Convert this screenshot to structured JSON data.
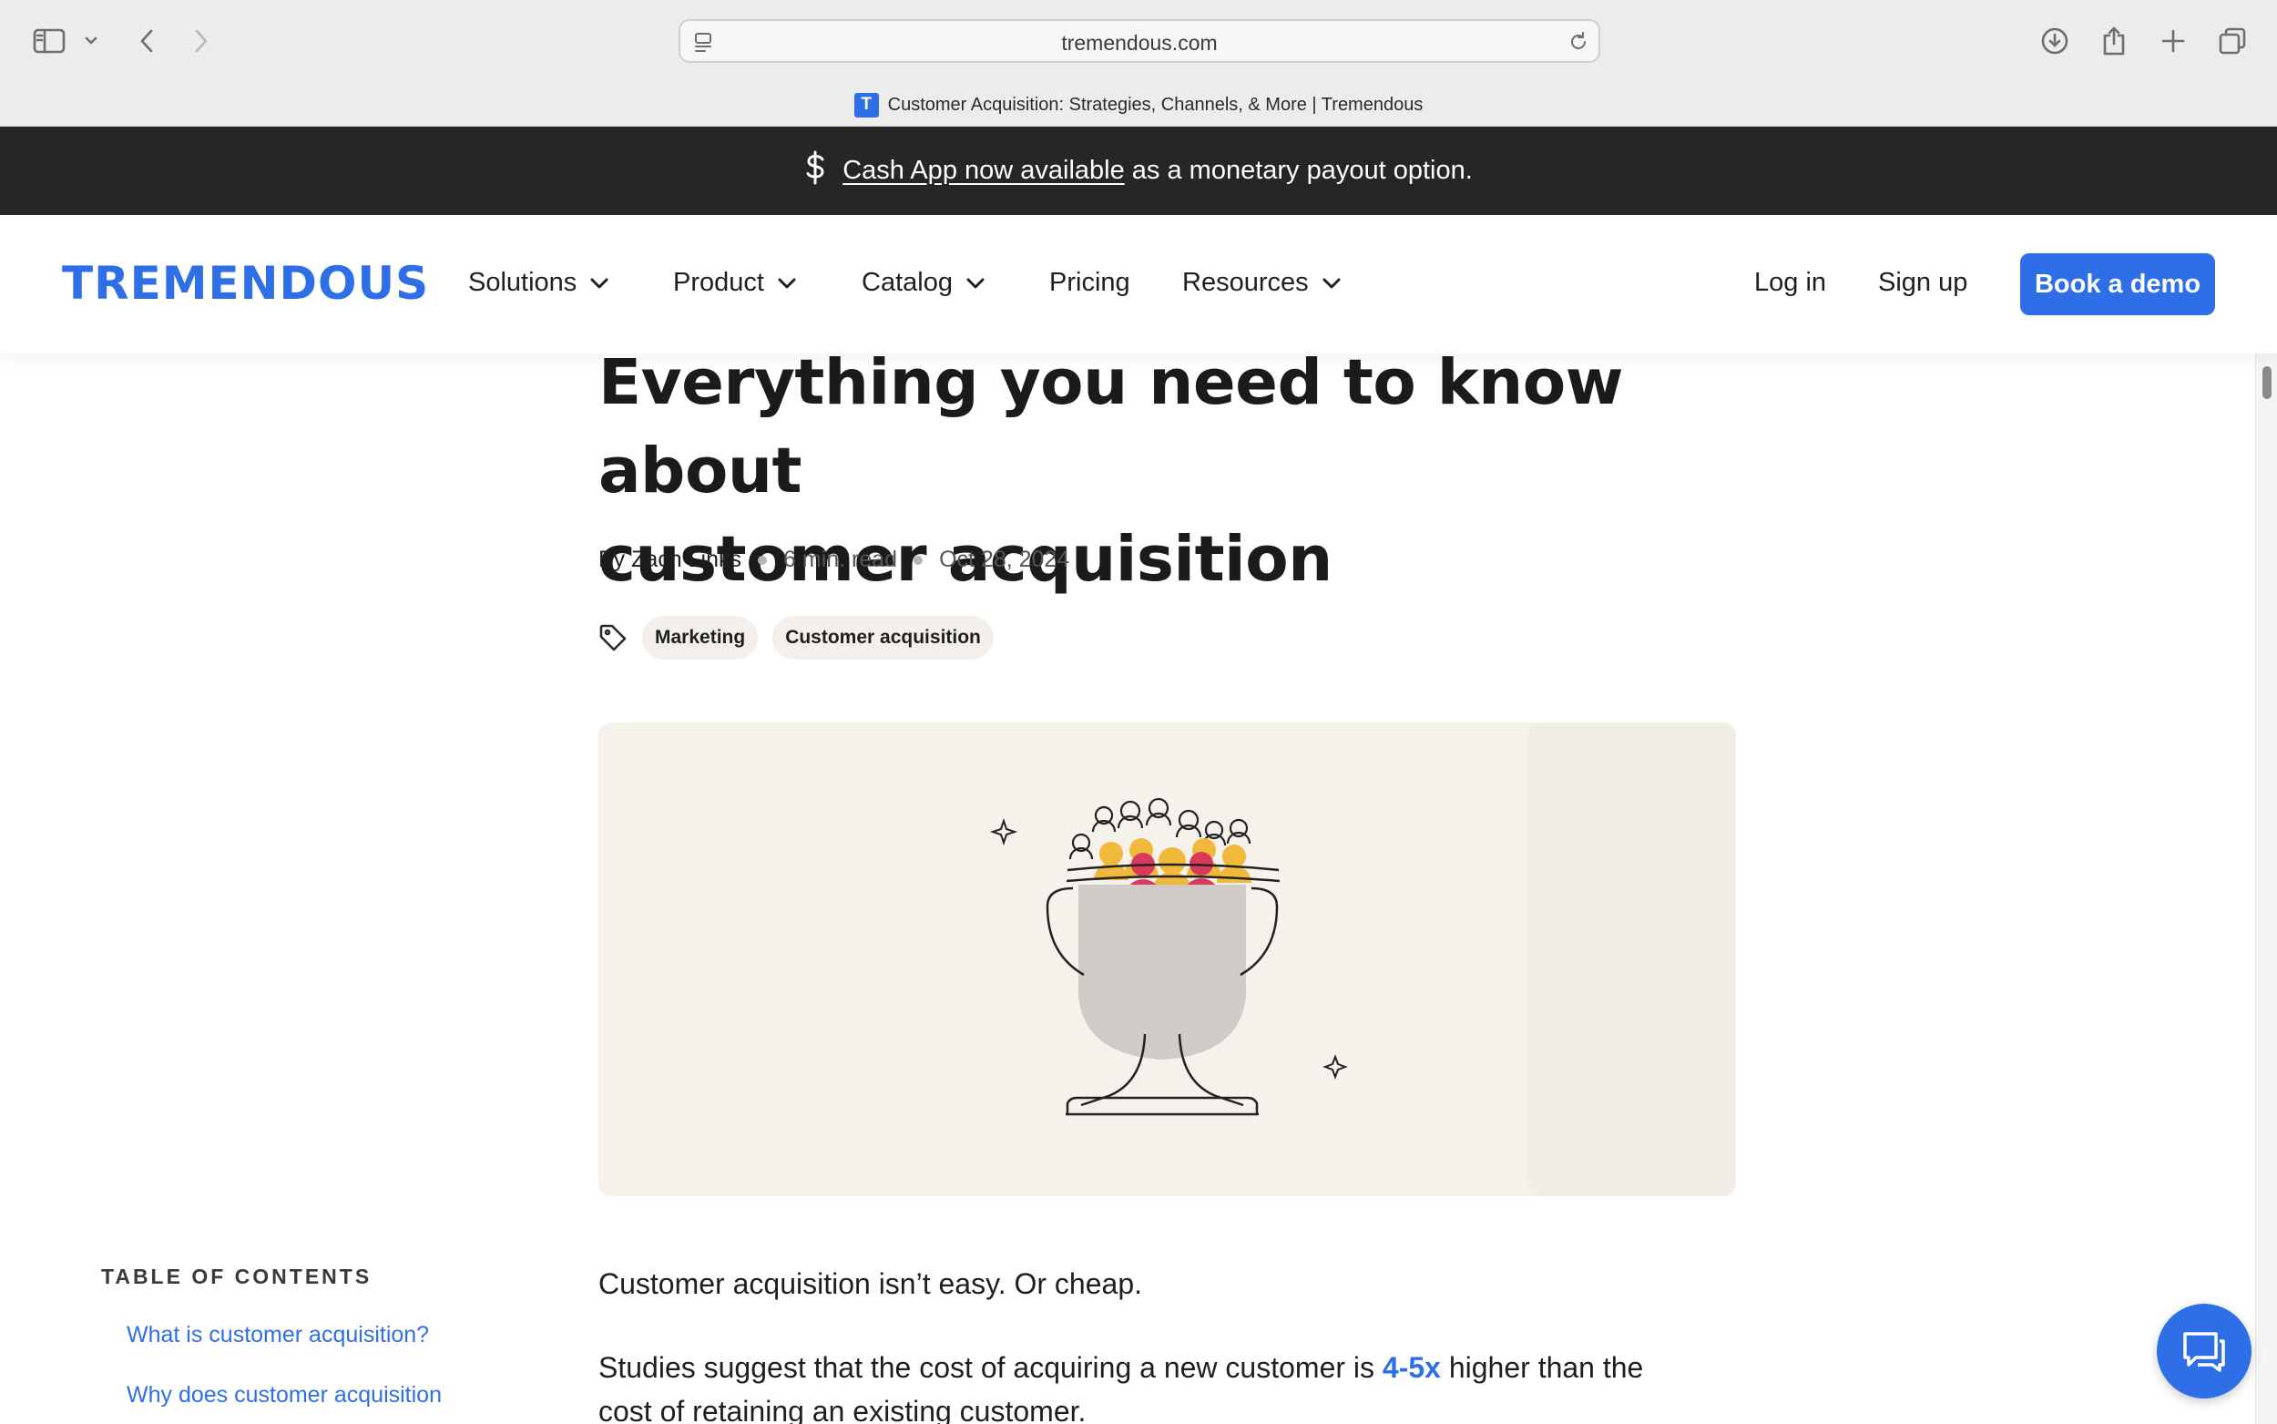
{
  "browser": {
    "url": "tremendous.com",
    "tab_title": "Customer Acquisition: Strategies, Channels, & More | Tremendous",
    "favicon_letter": "T"
  },
  "announcement": {
    "link_text": "Cash App now available",
    "rest_text": "as a monetary payout option.",
    "icon": "dollar-icon"
  },
  "nav": {
    "logo": "TREMENDOUS",
    "items": [
      {
        "label": "Solutions",
        "dropdown": true
      },
      {
        "label": "Product",
        "dropdown": true
      },
      {
        "label": "Catalog",
        "dropdown": true
      },
      {
        "label": "Pricing",
        "dropdown": false
      },
      {
        "label": "Resources",
        "dropdown": true
      }
    ],
    "login": "Log in",
    "signup": "Sign up",
    "cta": "Book a demo"
  },
  "article": {
    "title_line1": "Everything you need to know about",
    "title_line2": "customer acquisition",
    "author": "By Zach Links",
    "read_time": "6 min. read",
    "date": "Oct 28, 2024",
    "tags": [
      "Marketing",
      "Customer acquisition"
    ],
    "para1": "Customer acquisition isn’t easy. Or cheap.",
    "para2_before": "Studies suggest that the cost of acquiring a new customer is ",
    "para2_highlight": "4-5x",
    "para2_after": " higher than the",
    "para2_line2": "cost of retaining an existing customer."
  },
  "toc": {
    "heading": "TABLE OF CONTENTS",
    "items": [
      "What is customer acquisition?",
      "Why does customer acquisition"
    ]
  },
  "colors": {
    "brand": "#2e6ee6",
    "announce_bg": "#262626",
    "hero_bg": "#f5f2ec",
    "tag_bg": "#f3efea"
  }
}
